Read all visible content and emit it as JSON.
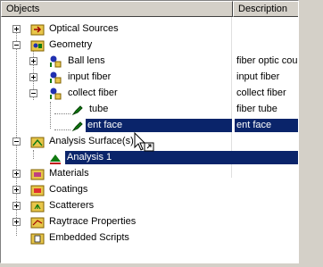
{
  "columns": {
    "objects": "Objects",
    "description": "Description"
  },
  "tree": [
    {
      "label": "Optical Sources",
      "description": "",
      "expander": "plus"
    },
    {
      "label": "Geometry",
      "description": "",
      "expander": "minus"
    },
    {
      "label": "Ball lens",
      "description": "fiber optic coup",
      "expander": "plus"
    },
    {
      "label": "input fiber",
      "description": "input fiber",
      "expander": "plus"
    },
    {
      "label": "collect fiber",
      "description": "collect fiber",
      "expander": "minus"
    },
    {
      "label": "tube",
      "description": "fiber tube",
      "expander": ""
    },
    {
      "label": "ent face",
      "description": "ent face",
      "expander": "",
      "selected": true
    },
    {
      "label": "Analysis Surface(s)",
      "description": "",
      "expander": "minus"
    },
    {
      "label": "Analysis 1",
      "description": "",
      "expander": "",
      "selected": true
    },
    {
      "label": "Materials",
      "description": "",
      "expander": "plus"
    },
    {
      "label": "Coatings",
      "description": "",
      "expander": "plus"
    },
    {
      "label": "Scatterers",
      "description": "",
      "expander": "plus"
    },
    {
      "label": "Raytrace Properties",
      "description": "",
      "expander": "plus"
    },
    {
      "label": "Embedded Scripts",
      "description": "",
      "expander": ""
    }
  ],
  "colors": {
    "selection": "#0a246a",
    "folder": "#e8c64a",
    "lens_blue": "#2030b0",
    "surface_green": "#107a10"
  }
}
